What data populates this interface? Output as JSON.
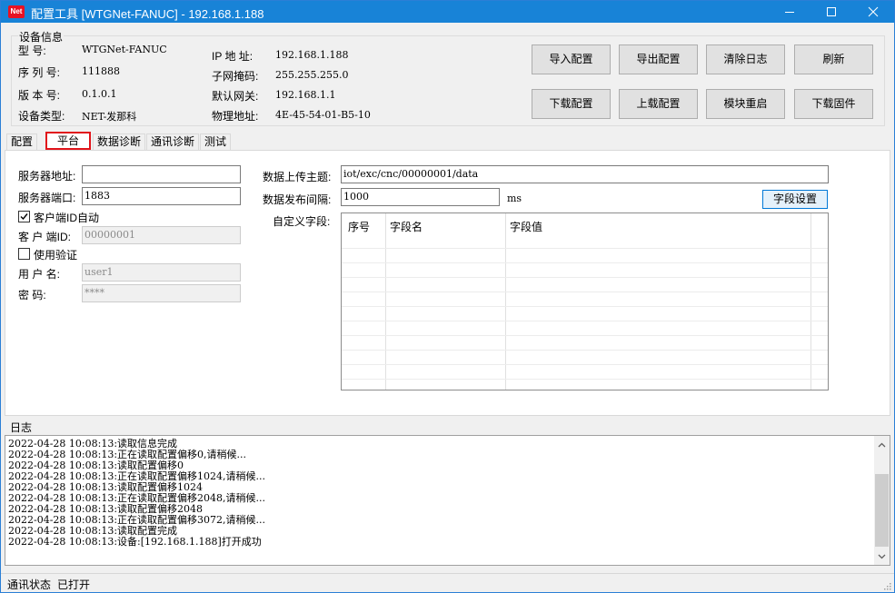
{
  "window": {
    "icon_text": "Net",
    "title": "配置工具 [WTGNet-FANUC] - 192.168.1.188"
  },
  "device_info": {
    "group_title": "设备信息",
    "model_label": "型    号:",
    "model_value": "WTGNet-FANUC",
    "serial_label": "序 列 号:",
    "serial_value": "111888",
    "version_label": "版 本 号:",
    "version_value": "0.1.0.1",
    "type_label": "设备类型:",
    "type_value": "NET-发那科",
    "ip_label": "IP 地 址:",
    "ip_value": "192.168.1.188",
    "mask_label": "子网掩码:",
    "mask_value": "255.255.255.0",
    "gateway_label": "默认网关:",
    "gateway_value": "192.168.1.1",
    "mac_label": "物理地址:",
    "mac_value": "4E-45-54-01-B5-10"
  },
  "toolbar": {
    "import_config": "导入配置",
    "export_config": "导出配置",
    "clear_log": "清除日志",
    "refresh": "刷新",
    "download_config": "下载配置",
    "upload_config": "上载配置",
    "module_restart": "模块重启",
    "download_firmware": "下载固件"
  },
  "tabs": [
    "配置",
    "平台",
    "数据诊断",
    "通讯诊断",
    "测试"
  ],
  "platform": {
    "server_addr_label": "服务器地址:",
    "server_addr_value": "",
    "server_port_label": "服务器端口:",
    "server_port_value": "1883",
    "client_id_auto_label": "客户端ID自动",
    "client_id_auto_checked": true,
    "client_id_label": "客 户 端ID:",
    "client_id_value": "00000001",
    "use_auth_label": "使用验证",
    "use_auth_checked": false,
    "username_label": "用  户  名:",
    "username_value": "user1",
    "password_label": "密      码:",
    "password_value": "****",
    "topic_label": "数据上传主题:",
    "topic_value": "iot/exc/cnc/00000001/data",
    "interval_label": "数据发布间隔:",
    "interval_value": "1000",
    "interval_unit": "ms",
    "field_settings_button": "字段设置",
    "custom_fields_label": "自定义字段:",
    "grid_columns": [
      "序号",
      "字段名",
      "字段值"
    ]
  },
  "log": {
    "label": "日志",
    "lines": [
      "2022-04-28 10:08:13:读取信息完成",
      "2022-04-28 10:08:13:正在读取配置偏移0,请稍候...",
      "2022-04-28 10:08:13:读取配置偏移0",
      "2022-04-28 10:08:13:正在读取配置偏移1024,请稍候...",
      "2022-04-28 10:08:13:读取配置偏移1024",
      "2022-04-28 10:08:13:正在读取配置偏移2048,请稍候...",
      "2022-04-28 10:08:13:读取配置偏移2048",
      "2022-04-28 10:08:13:正在读取配置偏移3072,请稍候...",
      "2022-04-28 10:08:13:读取配置完成",
      "2022-04-28 10:08:13:设备:[192.168.1.188]打开成功"
    ]
  },
  "status": {
    "label": "通讯状态",
    "value": "已打开"
  }
}
